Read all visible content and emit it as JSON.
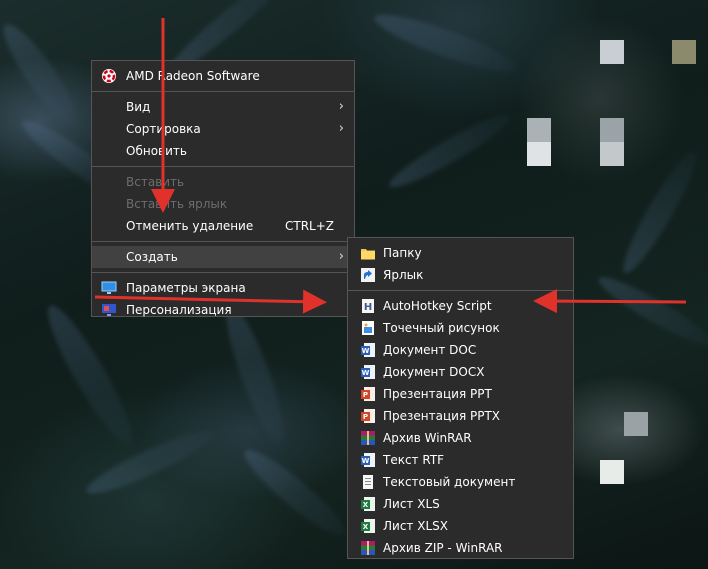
{
  "context_menu": {
    "items": [
      {
        "label": "AMD Radeon Software",
        "icon": "amd-radeon-icon"
      },
      {
        "label": "Вид",
        "submenu": true
      },
      {
        "label": "Сортировка",
        "submenu": true
      },
      {
        "label": "Обновить"
      },
      {
        "label": "Вставить",
        "disabled": true
      },
      {
        "label": "Вставить ярлык",
        "disabled": true
      },
      {
        "label": "Отменить удаление",
        "shortcut": "CTRL+Z"
      },
      {
        "label": "Создать",
        "submenu": true,
        "active": true
      },
      {
        "label": "Параметры экрана",
        "icon": "display-settings-icon"
      },
      {
        "label": "Персонализация",
        "icon": "personalization-icon"
      }
    ]
  },
  "submenu_create": {
    "items": [
      {
        "label": "Папку",
        "icon": "folder-icon"
      },
      {
        "label": "Ярлык",
        "icon": "shortcut-icon"
      },
      {
        "label": "AutoHotkey Script",
        "icon": "autohotkey-icon"
      },
      {
        "label": "Точечный рисунок",
        "icon": "bitmap-icon"
      },
      {
        "label": "Документ DOC",
        "icon": "word-doc-icon"
      },
      {
        "label": "Документ DOCX",
        "icon": "word-docx-icon"
      },
      {
        "label": "Презентация PPT",
        "icon": "powerpoint-ppt-icon"
      },
      {
        "label": "Презентация PPTX",
        "icon": "powerpoint-pptx-icon"
      },
      {
        "label": "Архив WinRAR",
        "icon": "winrar-icon"
      },
      {
        "label": "Текст RTF",
        "icon": "rtf-icon"
      },
      {
        "label": "Текстовый документ",
        "icon": "text-document-icon"
      },
      {
        "label": "Лист XLS",
        "icon": "excel-xls-icon"
      },
      {
        "label": "Лист XLSX",
        "icon": "excel-xlsx-icon"
      },
      {
        "label": "Архив ZIP - WinRAR",
        "icon": "winrar-zip-icon"
      }
    ]
  },
  "colors": {
    "menu_bg": "#2b2b2b",
    "menu_border": "#555555",
    "active_bg": "#414141",
    "disabled_text": "#6d6d6d",
    "annotation_arrow": "#e0322b"
  }
}
